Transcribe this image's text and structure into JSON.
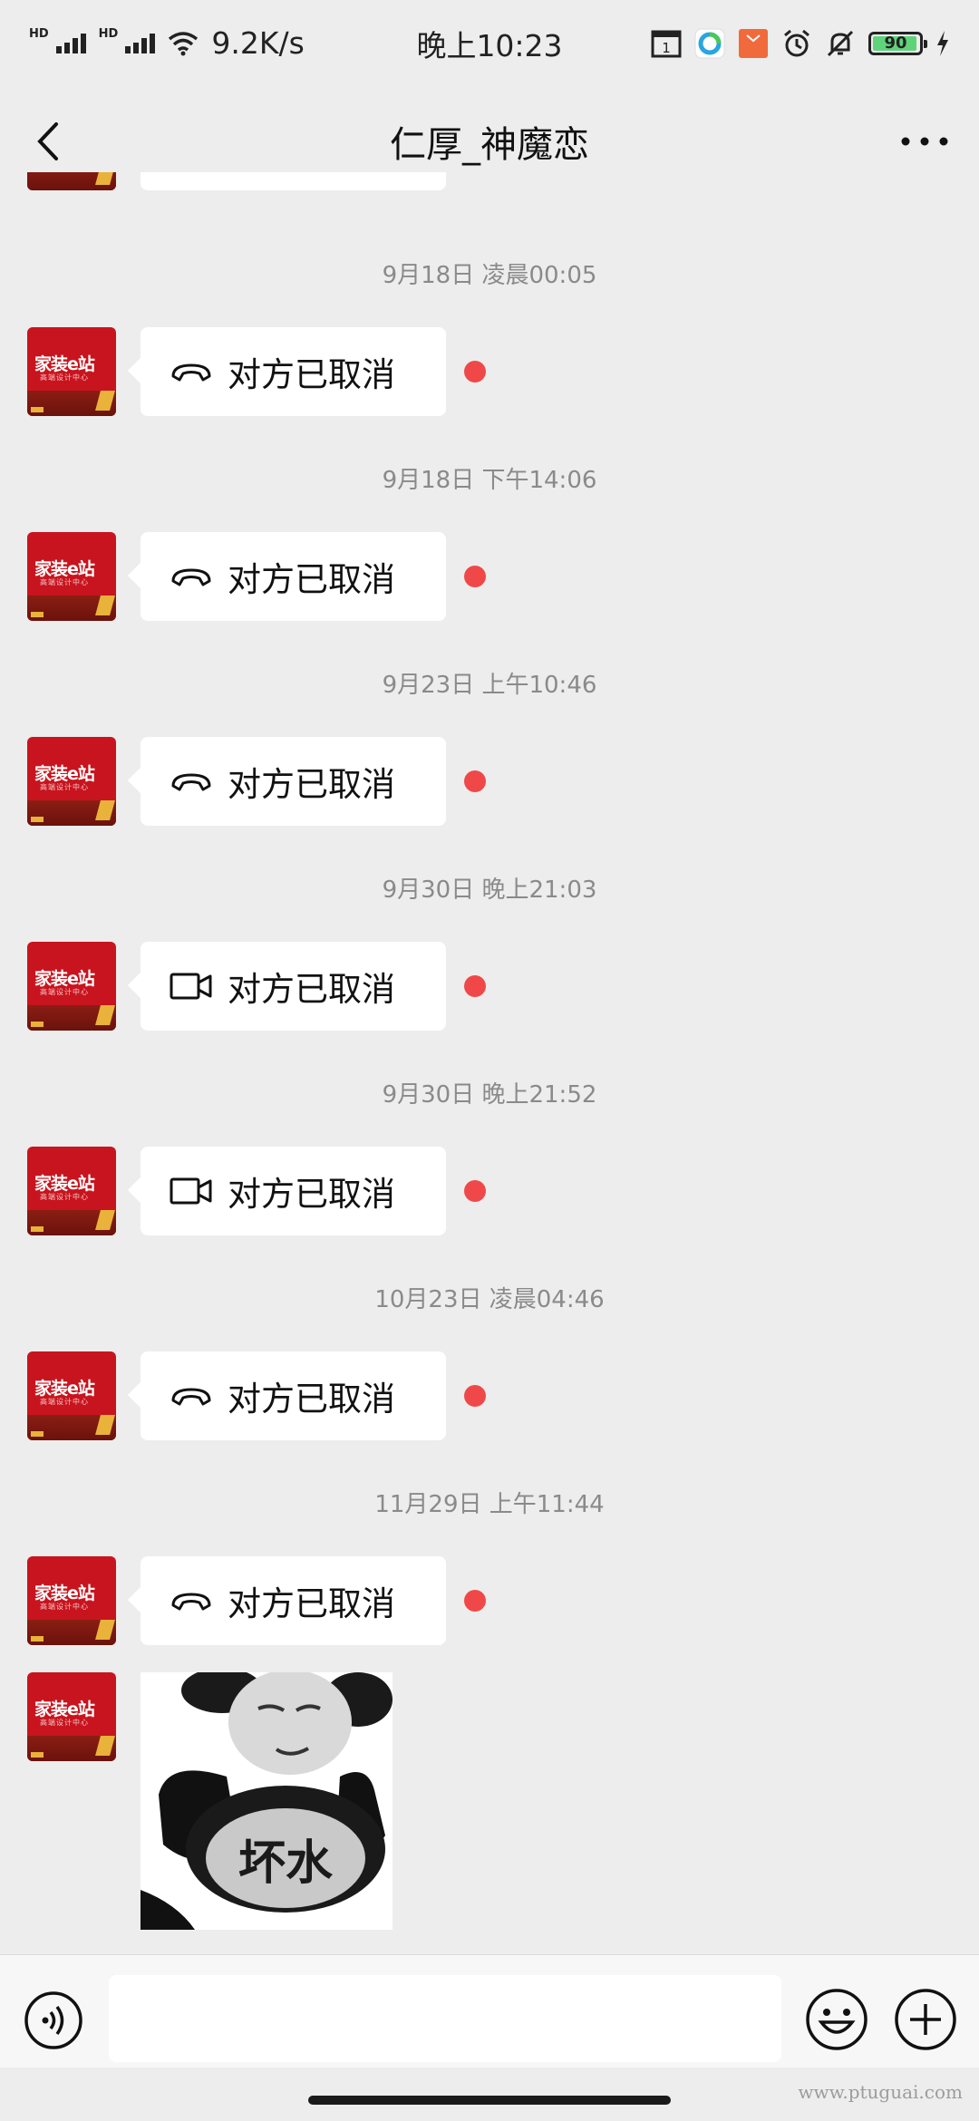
{
  "status_bar": {
    "net_speed": "9.2K/s",
    "time": "晚上10:23",
    "hd1": "HD",
    "hd2": "HD",
    "battery": "90"
  },
  "header": {
    "title": "仁厚_神魔恋"
  },
  "avatar": {
    "logo_text": "家装e站",
    "sub_text": "高端设计中心"
  },
  "messages": [
    {
      "timestamp": "9月18日 凌晨00:05",
      "call_type": "voice",
      "text": "对方已取消"
    },
    {
      "timestamp": "9月18日 下午14:06",
      "call_type": "voice",
      "text": "对方已取消"
    },
    {
      "timestamp": "9月23日 上午10:46",
      "call_type": "voice",
      "text": "对方已取消"
    },
    {
      "timestamp": "9月30日 晚上21:03",
      "call_type": "video",
      "text": "对方已取消"
    },
    {
      "timestamp": "9月30日 晚上21:52",
      "call_type": "video",
      "text": "对方已取消"
    },
    {
      "timestamp": "10月23日 凌晨04:46",
      "call_type": "voice",
      "text": "对方已取消"
    },
    {
      "timestamp": "11月29日 上午11:44",
      "call_type": "voice",
      "text": "对方已取消"
    }
  ],
  "sticker": {
    "caption": "坏水"
  },
  "colors": {
    "unread_dot": "#f04848",
    "avatar_red": "#c8141e",
    "background": "#ededed"
  },
  "watermark": "www.ptuguai.com"
}
